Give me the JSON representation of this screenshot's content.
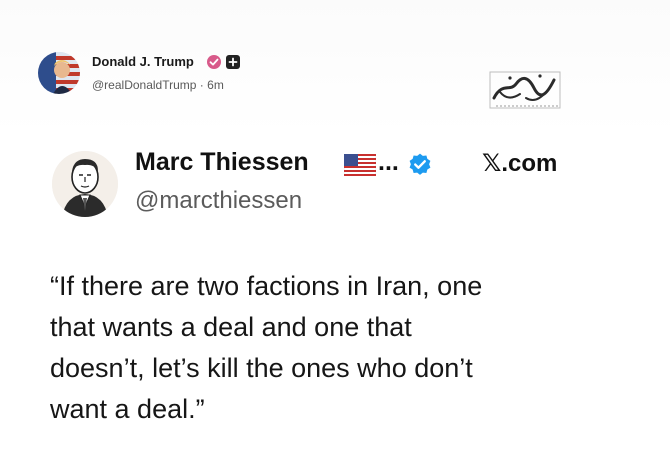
{
  "post": {
    "author_name": "Donald J. Trump",
    "author_handle": "@realDonaldTrump",
    "time_ago": "6m",
    "separator": "·",
    "avatar_icon": "flag-portrait-avatar",
    "badges": [
      "verified-pink-badge-icon",
      "plus-square-badge-icon"
    ]
  },
  "watermark": {
    "icon": "calligraphy-watermark-logo"
  },
  "card": {
    "author_name": "Marc Thiessen",
    "flag_icon": "us-flag-emoji-icon",
    "truncation": "...",
    "verified_icon": "verified-blue-badge-icon",
    "source": "𝕏.com",
    "author_handle": "@marcthiessen",
    "avatar_icon": "sketch-portrait-avatar",
    "quote_lines": [
      "“If there are two factions in Iran, one",
      "that wants a deal and one that",
      "doesn’t, let’s kill the ones who don’t",
      "want a deal.”"
    ]
  },
  "colors": {
    "text_primary": "#111111",
    "text_secondary": "#5b5b5b",
    "verified_blue": "#1d9bf0",
    "badge_pink": "#d85a8a"
  }
}
